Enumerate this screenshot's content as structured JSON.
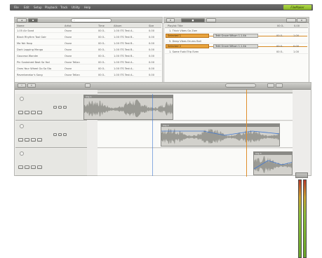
{
  "menubar": {
    "items": [
      "File",
      "Edit",
      "Setup",
      "Playback",
      "Track",
      "Utility",
      "Help"
    ],
    "brand": "FileMaker"
  },
  "colors": {
    "accent": "#e8a33c",
    "brand": "#9ccb36",
    "meter_top": "#b63a2a",
    "meter_bottom": "#6aa52a",
    "playhead": "#e08f2c"
  },
  "library": {
    "columns": [
      "Name",
      "Artist",
      "Time",
      "Album",
      "Size"
    ],
    "rows": [
      [
        "1.05 Air Sand",
        "Oscar",
        "00:3..",
        "1.00 ITS Test A..",
        "0.00"
      ],
      [
        "Black Rhythm Tool Gain",
        "Oscar",
        "00:3..",
        "1.00 ITS Test B..",
        "0.00"
      ],
      [
        "Mo Yok Yoop",
        "Oscar",
        "00:3..",
        "1.00 ITS Test B..",
        "0.00"
      ],
      [
        "Dark Lapping Mango",
        "Oscar",
        "00:3..",
        "1.00 ITS Test B..",
        "0.00"
      ],
      [
        "Gaucesa Wonder",
        "Oscar",
        "00:3..",
        "1.00 ITS Test B..",
        "0.00"
      ],
      [
        "Pin Sustained Beat So Yod",
        "Oscar Tellan",
        "00:3..",
        "1.00 ITS Test A..",
        "0.00"
      ],
      [
        "Ones Your Wheel Go So Sto",
        "Oscar",
        "00:3..",
        "1.00 ITS Test A..",
        "0.00"
      ],
      [
        "Reverberator's Song",
        "Oscar Tellan",
        "00:3..",
        "1.00 ITS Test A..",
        "0.00"
      ]
    ]
  },
  "playlist": {
    "hdr_tabs": [
      "",
      "",
      ""
    ],
    "col_title": "Playlist Title",
    "col_right": [
      "00:3..",
      "0.00"
    ],
    "items": [
      {
        "label": "1. Thick Vibes Go Zam",
        "style": "plain"
      },
      {
        "label": "Selected 1",
        "style": "highlight",
        "tag": "Tetti Grove Wilson 1.1.4b"
      },
      {
        "label": "5. Deep Vibes Drums Ball",
        "style": "plain"
      },
      {
        "label": "Selected 2",
        "style": "highlight",
        "tag": "Tetti Grove Wilson 1.1.4b"
      },
      {
        "label": "1. Some Fudd Trip Even",
        "style": "plain"
      }
    ],
    "right_values": [
      "00:3..",
      "1.00",
      "00:3..",
      "0.00",
      "00:3..",
      "1.00"
    ]
  },
  "arrangement": {
    "clips": [
      {
        "label": "Clip 1"
      },
      {
        "label": "Clip 2"
      },
      {
        "label": "Clip 3"
      }
    ]
  }
}
